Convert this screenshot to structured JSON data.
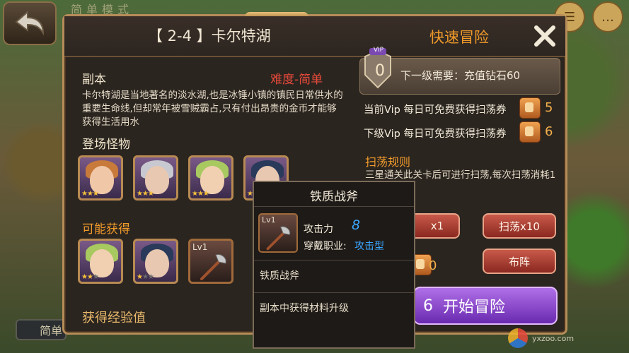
{
  "background": {
    "title": "简单模式",
    "bottom_button": "简单"
  },
  "dialog": {
    "title": "【 2-4 】卡尔特湖",
    "quick_title": "快速冒险",
    "stage_label": "副本",
    "difficulty": "难度-简单",
    "description": "卡尔特湖是当地著名的淡水湖,也是冰锤小镇的镇民日常供水的重要生命线,但却常年被雪贼霸占,只有付出昂贵的金币才能够获得生活用水",
    "monsters_label": "登场怪物",
    "drops_label": "可能获得",
    "exp_label": "获得经验值",
    "monsters": [
      {
        "stars": 3,
        "max": 3
      },
      {
        "stars": 3,
        "max": 3
      },
      {
        "stars": 3,
        "max": 3
      },
      {
        "stars": 3,
        "max": 3
      }
    ],
    "drops": [
      {
        "stars": 2,
        "max": 3
      },
      {
        "stars": 1,
        "max": 3
      },
      {
        "lv": "Lv1"
      }
    ]
  },
  "vip": {
    "level": "0",
    "badge": "VIP",
    "next_need": "下一级需要：充值钻石60",
    "current_row": "当前Vip 每日可免费获得扫荡券",
    "current_count": "5",
    "next_row": "下级Vip 每日可免费获得扫荡券",
    "next_count": "6"
  },
  "rules": {
    "title": "扫荡规则",
    "text": "三星通关此关卡后可进行扫荡,每次扫荡消耗1张扫荡券。"
  },
  "buttons": {
    "sweep1": "x1",
    "sweep10": "扫荡x10",
    "formation": "布阵",
    "scroll_count": "0",
    "start_num": "6",
    "start_label": "开始冒险"
  },
  "tooltip": {
    "title": "铁质战斧",
    "lv": "Lv1",
    "atk_label": "攻击力",
    "atk_value": "8",
    "job_label": "穿戴职业:",
    "job_value": "攻击型",
    "name": "铁质战斧",
    "desc": "副本中获得材料升级"
  },
  "watermark": "yxzoo.com",
  "colors": {
    "accent_orange": "#f09a2a",
    "difficulty_red": "#e84a3a",
    "stat_blue": "#3aa6ff",
    "start_purple": "#8a3ad0"
  }
}
